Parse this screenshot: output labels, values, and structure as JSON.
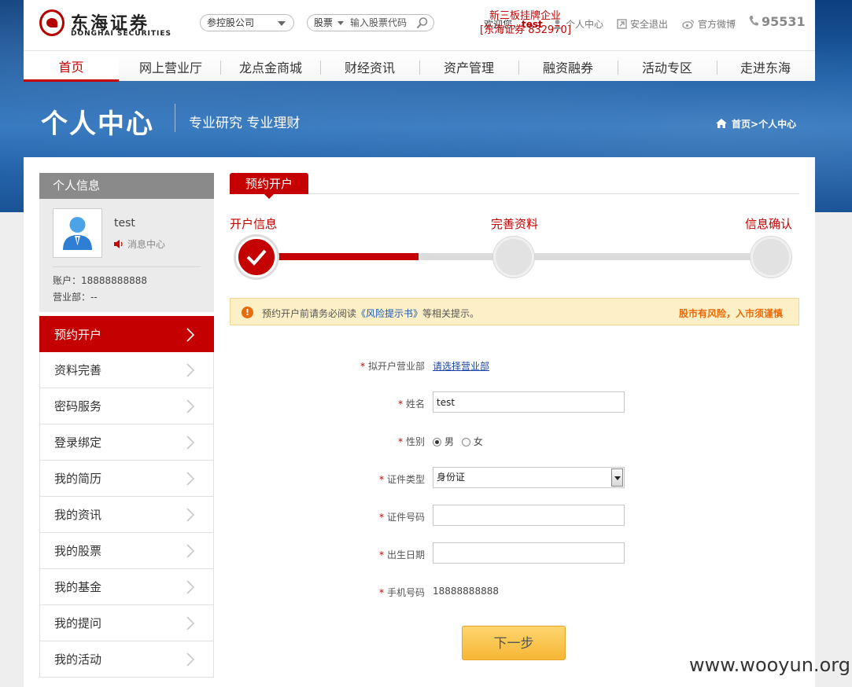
{
  "header": {
    "logo": {
      "cn": "东海证券",
      "en": "DONGHAI SECURITIES"
    },
    "company_select": {
      "value": "参控股公司"
    },
    "stock_search": {
      "type": "股票",
      "placeholder": "输入股票代码"
    },
    "welcome": {
      "prefix": "欢迎您，",
      "user": "test"
    },
    "overlay": {
      "line1": "新三板挂牌企业",
      "line2": "[东海证券 832970]"
    },
    "links": {
      "personal_center": "个人中心",
      "logout": "安全退出",
      "weibo": "官方微博"
    },
    "hotline": "95531"
  },
  "nav": {
    "items": [
      {
        "label": "首页"
      },
      {
        "label": "网上营业厅"
      },
      {
        "label": "龙点金商城"
      },
      {
        "label": "财经资讯"
      },
      {
        "label": "资产管理"
      },
      {
        "label": "融资融券"
      },
      {
        "label": "活动专区"
      },
      {
        "label": "走进东海"
      }
    ],
    "active": "首页"
  },
  "banner": {
    "title": "个人中心",
    "subtitle": "专业研究 专业理财",
    "breadcrumb": {
      "home": "首页",
      "sep": ">",
      "current": "个人中心"
    }
  },
  "sidebar": {
    "heading": "个人信息",
    "username": "test",
    "message_center": "消息中心",
    "account": "账户：18888888888",
    "branch": "营业部：--",
    "menu": [
      {
        "label": "预约开户"
      },
      {
        "label": "资料完善"
      },
      {
        "label": "密码服务"
      },
      {
        "label": "登录绑定"
      },
      {
        "label": "我的简历"
      },
      {
        "label": "我的资讯"
      },
      {
        "label": "我的股票"
      },
      {
        "label": "我的基金"
      },
      {
        "label": "我的提问"
      },
      {
        "label": "我的活动"
      }
    ],
    "active": "预约开户"
  },
  "main": {
    "tab": "预约开户",
    "steps": [
      {
        "label": "开户信息"
      },
      {
        "label": "完善资料"
      },
      {
        "label": "信息确认"
      }
    ],
    "notice": {
      "before": "预约开户前请务必阅读",
      "link": "《风险提示书》",
      "after": "等相关提示。",
      "risk": "股市有风险，入市须谨慎"
    },
    "form": {
      "branch": {
        "label": "拟开户营业部",
        "link": "请选择营业部"
      },
      "name": {
        "label": "姓名",
        "value": "test"
      },
      "gender": {
        "label": "性别",
        "male": "男",
        "female": "女",
        "selected": "男"
      },
      "id_type": {
        "label": "证件类型",
        "value": "身份证"
      },
      "id_number": {
        "label": "证件号码",
        "value": ""
      },
      "birth_date": {
        "label": "出生日期",
        "value": ""
      },
      "mobile": {
        "label": "手机号码",
        "value": "18888888888"
      }
    },
    "next_button": "下一步"
  },
  "watermark": "www.wooyun.org",
  "colors": {
    "brand_red": "#c40000",
    "banner_blue": "#1e5fa6",
    "button_orange": "#f6b735"
  }
}
